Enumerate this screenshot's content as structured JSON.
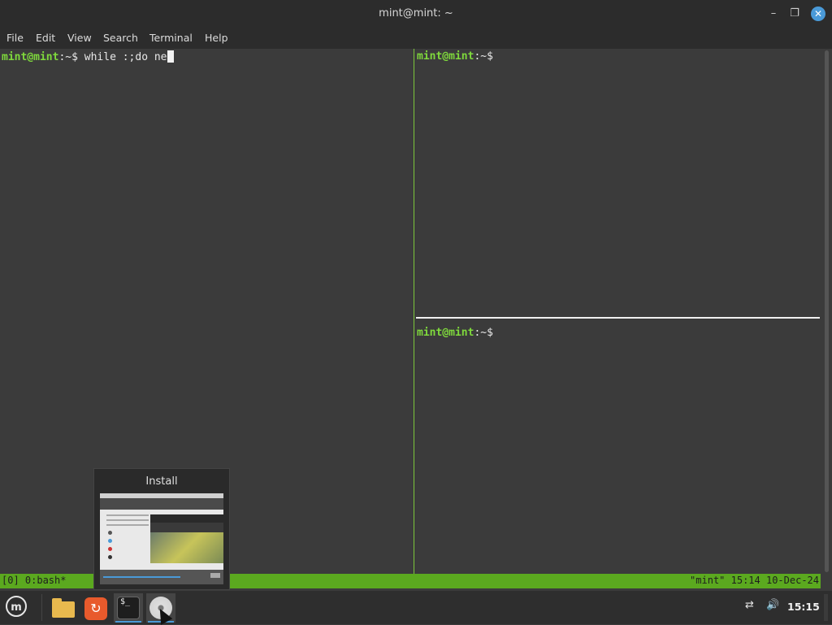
{
  "window": {
    "title": "mint@mint: ~",
    "minimize_icon": "minimize-icon",
    "maximize_icon": "maximize-icon",
    "close_icon": "close-icon"
  },
  "menu": {
    "items": [
      "File",
      "Edit",
      "View",
      "Search",
      "Terminal",
      "Help"
    ]
  },
  "panes": {
    "left": {
      "user": "mint@mint",
      "path": ":~$",
      "command": " while :;do ne"
    },
    "top_right": {
      "user": "mint@mint",
      "path": ":~$"
    },
    "bottom_right": {
      "user": "mint@mint",
      "path": ":~$"
    }
  },
  "status": {
    "left": "[0] 0:bash*",
    "right": "\"mint\" 15:14 10-Dec-24",
    "color": "#5ba91f"
  },
  "preview": {
    "title": "Install"
  },
  "taskbar": {
    "apps": [
      {
        "name": "menu",
        "icon": "linux-mint-logo-icon"
      },
      {
        "name": "files",
        "icon": "folder-icon"
      },
      {
        "name": "update-manager",
        "icon": "update-icon"
      },
      {
        "name": "terminal",
        "icon": "terminal-icon",
        "label": "$_"
      },
      {
        "name": "installer",
        "icon": "disc-icon"
      }
    ],
    "clock": "15:15",
    "network_icon": "network-disconnected-icon",
    "volume_icon": "volume-icon"
  },
  "colors": {
    "prompt_green": "#7fd93c",
    "accent_blue": "#4a9ad8"
  }
}
